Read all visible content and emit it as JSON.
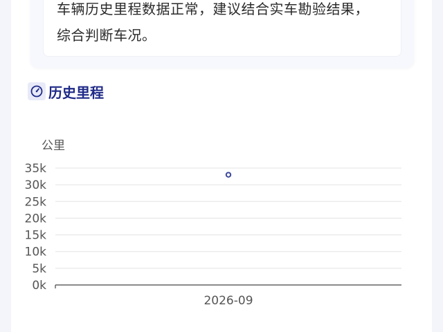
{
  "summary": {
    "line1": "车辆历史里程数据正常，建议结合实车勘验结果，",
    "line2": "综合判断车况。"
  },
  "section": {
    "title": "历史里程",
    "icon": "gauge-icon",
    "accent_color": "#1f2a87"
  },
  "chart_data": {
    "type": "scatter",
    "title": "",
    "xlabel": "",
    "ylabel": "公里",
    "y_ticks": [
      "0k",
      "5k",
      "10k",
      "15k",
      "20k",
      "25k",
      "30k",
      "35k"
    ],
    "ylim": [
      0,
      35000
    ],
    "x_ticks": [
      "2026-09"
    ],
    "series": [
      {
        "points": [
          {
            "x": "2026-09",
            "y": 33000
          }
        ],
        "color": "#3f4a9c"
      }
    ],
    "grid": true
  }
}
